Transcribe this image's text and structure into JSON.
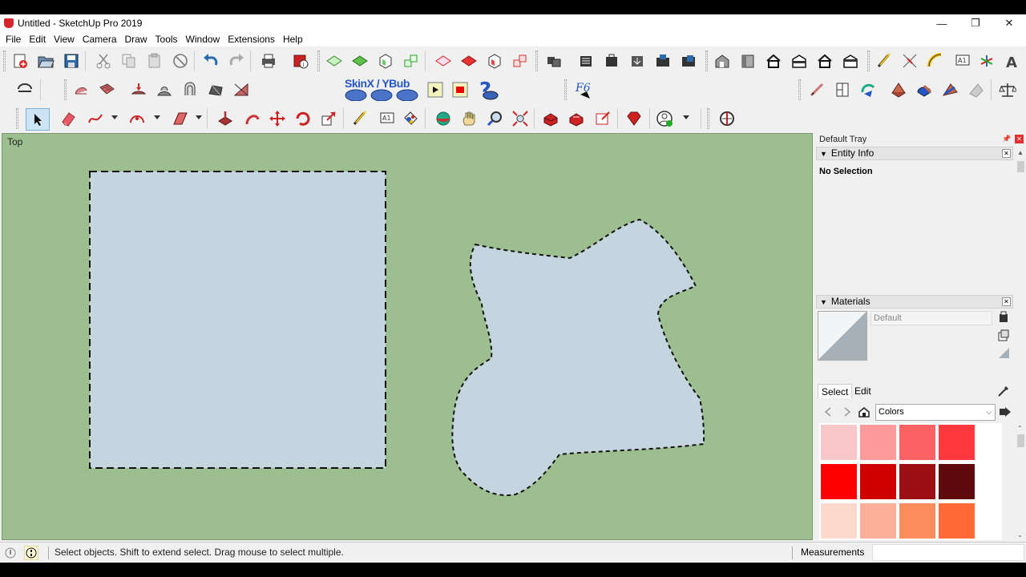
{
  "window": {
    "title": "Untitled - SketchUp Pro 2019",
    "controls": {
      "minimize": "—",
      "restore": "❐",
      "close": "✕"
    }
  },
  "menu": [
    "File",
    "Edit",
    "View",
    "Camera",
    "Draw",
    "Tools",
    "Window",
    "Extensions",
    "Help"
  ],
  "toolbar": {
    "skinxybub_label": "SkinX / YBub"
  },
  "viewport": {
    "view_label": "Top",
    "background": "#9dbe8f",
    "face_color": "#c5d5e0"
  },
  "tray": {
    "title": "Default Tray",
    "entity_info": {
      "header": "Entity Info",
      "selection_text": "No Selection"
    },
    "materials": {
      "header": "Materials",
      "material_name": "Default",
      "tabs": [
        "Select",
        "Edit"
      ],
      "active_tab": "Select",
      "library": "Colors",
      "swatch_colors": [
        [
          "#f8c7c9",
          "#fc9a9c",
          "#fd6265",
          "#fe383d"
        ],
        [
          "#fe0000",
          "#d00000",
          "#9a0e14",
          "#5f0a0c"
        ],
        [
          "#fcd8cc",
          "#fcb09a",
          "#fa8c5e",
          "#fe6a38"
        ],
        [
          "#fe4600",
          "#c73a05",
          "#9d2d11",
          "#6e1f0d"
        ]
      ]
    }
  },
  "status": {
    "message": "Select objects. Shift to extend select. Drag mouse to select multiple.",
    "measurements_label": "Measurements",
    "measurements_value": ""
  }
}
